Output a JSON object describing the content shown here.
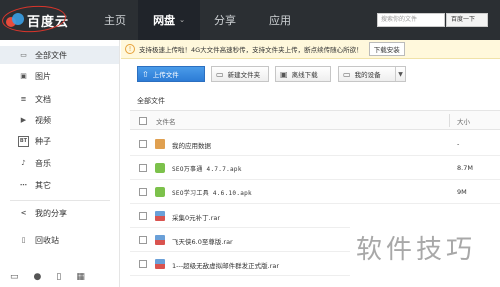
{
  "app": {
    "logo_text": "百度云",
    "nav": [
      {
        "label": "主页",
        "active": false
      },
      {
        "label": "网盘",
        "active": true,
        "caret": "⌄"
      },
      {
        "label": "分享",
        "active": false
      },
      {
        "label": "应用",
        "active": false
      }
    ],
    "search_placeholder": "搜索你的文件",
    "search_button": "百度一下"
  },
  "sidebar": {
    "items": [
      {
        "label": "全部文件",
        "icon": "folder-icon",
        "glyph": "▭",
        "active": true
      },
      {
        "label": "图片",
        "icon": "image-icon",
        "glyph": "▣"
      },
      {
        "label": "文档",
        "icon": "document-icon",
        "glyph": "≡"
      },
      {
        "label": "视频",
        "icon": "video-icon",
        "glyph": "▶"
      },
      {
        "label": "种子",
        "icon": "bt-icon",
        "glyph": "BT"
      },
      {
        "label": "音乐",
        "icon": "music-icon",
        "glyph": "♪"
      },
      {
        "label": "其它",
        "icon": "other-icon",
        "glyph": "⋯"
      },
      {
        "label": "我的分享",
        "icon": "share-icon",
        "glyph": "<"
      },
      {
        "label": "回收站",
        "icon": "trash-icon",
        "glyph": "▯"
      }
    ],
    "footer_icons": [
      "computer-icon",
      "android-icon",
      "phone-icon",
      "apps-icon"
    ]
  },
  "notice": {
    "text": "支持极速上传啦！4G大文件高速秒传，支持文件夹上传，断点续传随心所欲！",
    "button": "下载安装"
  },
  "toolbar": {
    "upload": "上传文件",
    "new_folder": "新建文件夹",
    "offline_download": "离线下载",
    "my_devices": "我的设备"
  },
  "breadcrumb": "全部文件",
  "table": {
    "header_name": "文件名",
    "header_size": "大小",
    "rows": [
      {
        "name": "我的应用数据",
        "type": "folder",
        "size": "-"
      },
      {
        "name": "SEO万事通 4.7.7.apk",
        "type": "apk",
        "size": "8.7M"
      },
      {
        "name": "SEO学习工具 4.6.10.apk",
        "type": "apk",
        "size": "9M"
      },
      {
        "name": "采集0元补丁.rar",
        "type": "rar",
        "size": ""
      },
      {
        "name": "飞天侠6.0至尊版.rar",
        "type": "rar",
        "size": ""
      },
      {
        "name": "1---超级无敌虚拟邮件群发正式版.rar",
        "type": "rar",
        "size": ""
      }
    ]
  },
  "watermark": "软件技巧",
  "colors": {
    "topbar": "#2b2f33",
    "accent_blue": "#2d7cd6",
    "notice_bg": "#fff8dc"
  }
}
